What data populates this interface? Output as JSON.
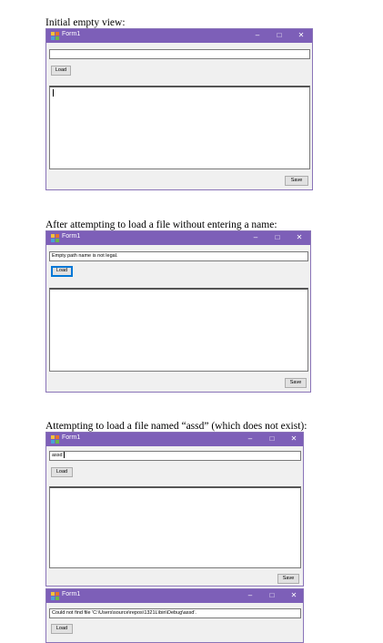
{
  "captions": {
    "c1": "Initial empty view:",
    "c2": "After attempting to load a file without entering a name:",
    "c3": "Attempting to load a file named “assd” (which does not exist):"
  },
  "window": {
    "title": "Form1",
    "min_glyph": "–",
    "max_glyph": "□",
    "close_glyph": "✕",
    "load_label": "Load",
    "save_label": "Save",
    "icon": "form-app-icon"
  },
  "views": {
    "v1": {
      "path_value": "",
      "textarea_value": ""
    },
    "v2": {
      "path_value": "Empty path name is not legal.",
      "textarea_value": ""
    },
    "v3": {
      "path_value": "assd",
      "textarea_value": ""
    },
    "v4": {
      "path_value": "Could not find file 'C:\\Users\\source\\repos\\1321L\\bin\\Debug\\assd'."
    }
  },
  "colors": {
    "titlebar": "#7d5fb8",
    "window_bg": "#f0f0f0",
    "focus": "#0078d7"
  }
}
